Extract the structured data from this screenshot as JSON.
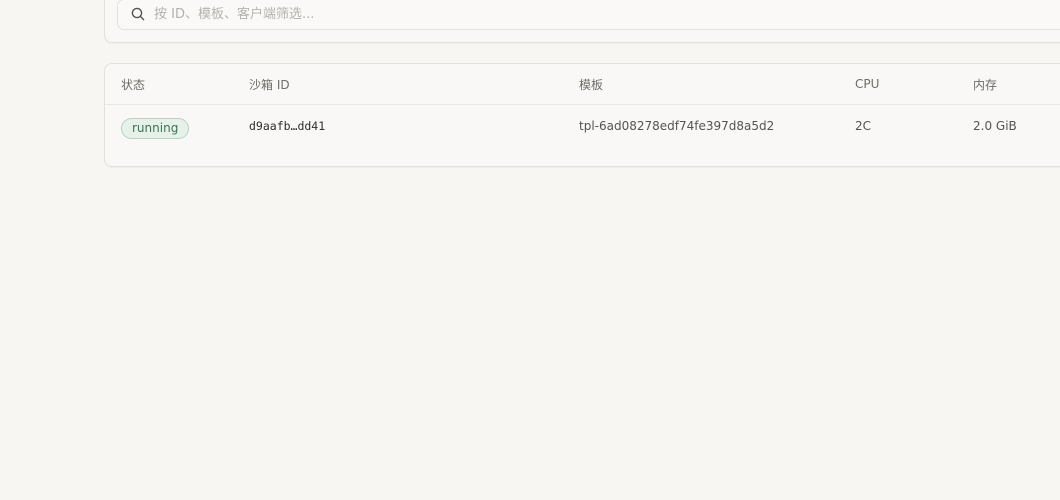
{
  "search": {
    "placeholder": "按 ID、模板、客户端筛选...",
    "value": ""
  },
  "table": {
    "columns": [
      "状态",
      "沙箱 ID",
      "模板",
      "CPU",
      "内存"
    ],
    "rows": [
      {
        "status": "running",
        "sandbox_id": "d9aafb…dd41",
        "template": "tpl-6ad08278edf74fe397d8a5d2",
        "cpu": "2C",
        "memory": "2.0 GiB"
      }
    ]
  },
  "colors": {
    "background": "#f7f6f3",
    "status_running_bg": "#e6f1ea",
    "status_running_text": "#3c7352"
  }
}
